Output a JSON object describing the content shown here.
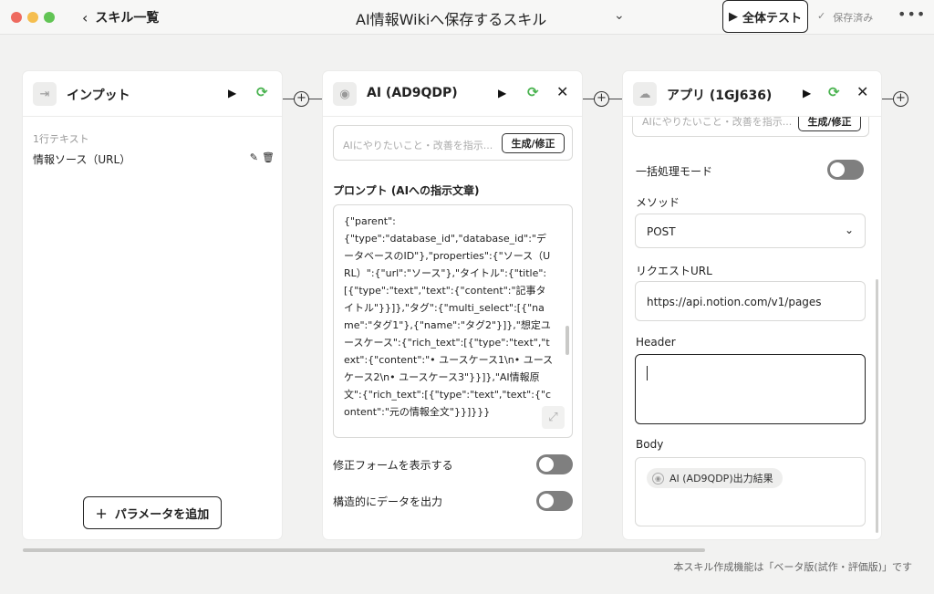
{
  "window": {
    "back_label": "スキル一覧",
    "title": "AI情報Wikiへ保存するスキル",
    "run_all_label": "全体テスト",
    "saved_label": "保存済み"
  },
  "input_card": {
    "title": "インプット",
    "field_type": "1行テキスト",
    "param_name": "情報ソース（URL）",
    "add_param_label": "パラメータを追加"
  },
  "ai_card": {
    "title": "AI (AD9QDP)",
    "ask_placeholder": "AIにやりたいこと・改善を指示...",
    "generate_label": "生成/修正",
    "prompt_label": "プロンプト (AIへの指示文章)",
    "prompt_text": "{\"parent\":\n{\"type\":\"database_id\",\"database_id\":\"データベースのID\"},\"properties\":{\"ソース（URL）\":{\"url\":\"ソース\"},\"タイトル\":{\"title\":[{\"type\":\"text\",\"text\":{\"content\":\"記事タイトル\"}}]},\"タグ\":{\"multi_select\":[{\"name\":\"タグ1\"},{\"name\":\"タグ2\"}]},\"想定ユースケース\":{\"rich_text\":[{\"type\":\"text\",\"text\":{\"content\":\"• ユースケース1\\n• ユースケース2\\n• ユースケース3\"}}]},\"AI情報原文\":{\"rich_text\":[{\"type\":\"text\",\"text\":{\"content\":\"元の情報全文\"}}]}}}",
    "toggle_form_label": "修正フォームを表示する",
    "toggle_structured_label": "構造的にデータを出力"
  },
  "app_card": {
    "title": "アプリ (1GJ636)",
    "ask_placeholder": "AIにやりたいこと・改善を指示...",
    "generate_label": "生成/修正",
    "batch_label": "一括処理モード",
    "method_label": "メソッド",
    "method_value": "POST",
    "url_label": "リクエストURL",
    "url_value": "https://api.notion.com/v1/pages",
    "header_label": "Header",
    "header_value": "",
    "body_label": "Body",
    "body_chip": "AI (AD9QDP)出力結果"
  },
  "footer_note": "本スキル作成機能は「ベータ版(試作・評価版)」です",
  "colors": {
    "sync_green": "#49b34f",
    "toggle_off": "#7f7f7f",
    "background": "#f2f2f1"
  },
  "icons": [
    "chevron-left-icon",
    "chevron-down-icon",
    "play-icon",
    "sync-icon",
    "close-icon",
    "plus-circle-icon",
    "pencil-icon",
    "trash-icon",
    "input-icon",
    "ai-icon",
    "cloud-icon",
    "expand-icon",
    "check-icon",
    "more-icon"
  ]
}
